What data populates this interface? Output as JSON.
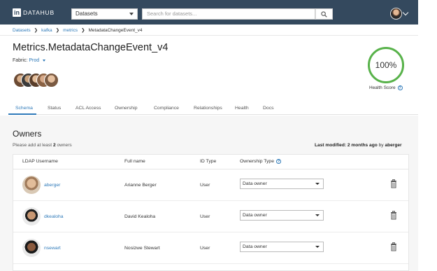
{
  "nav": {
    "logo_in": "in",
    "logo_text": "DATAHUB",
    "dataset_select": "Datasets",
    "search_placeholder": "Search for datasets..."
  },
  "breadcrumb": [
    "Datasets",
    "kafka",
    "metrics",
    "MetadataChangeEvent_v4"
  ],
  "header": {
    "title": "Metrics.MetadataChangeEvent_v4",
    "fabric_label": "Fabric:",
    "fabric_value": "Prod",
    "health_value": "100%",
    "health_label": "Health Score",
    "health_help": "?"
  },
  "tabs": [
    "Schema",
    "Status",
    "ACL Access",
    "Ownership",
    "Compliance",
    "Relationships",
    "Health",
    "Docs"
  ],
  "owners": {
    "title": "Owners",
    "hint_prefix": "Please add at least",
    "hint_count": "2",
    "hint_suffix": "owners",
    "last_modified_label": "Last modified:",
    "last_modified_value": "2 months ago",
    "last_modified_by": "by",
    "last_modified_user": "aberger",
    "columns": [
      "LDAP Username",
      "Full name",
      "ID Type",
      "Ownership Type"
    ],
    "ownership_help": "?",
    "rows": [
      {
        "username": "aberger",
        "full_name": "Arianne Berger",
        "id_type": "User",
        "ownership_type": "Data owner"
      },
      {
        "username": "dkealoha",
        "full_name": "David Kealoha",
        "id_type": "User",
        "ownership_type": "Data owner"
      },
      {
        "username": "nsewart",
        "full_name": "Nosizwe Stewart",
        "id_type": "User",
        "ownership_type": "Data owner"
      }
    ]
  },
  "colors": {
    "nav_bg": "#34495e",
    "accent": "#2f7ab9",
    "health": "#58b24a"
  }
}
